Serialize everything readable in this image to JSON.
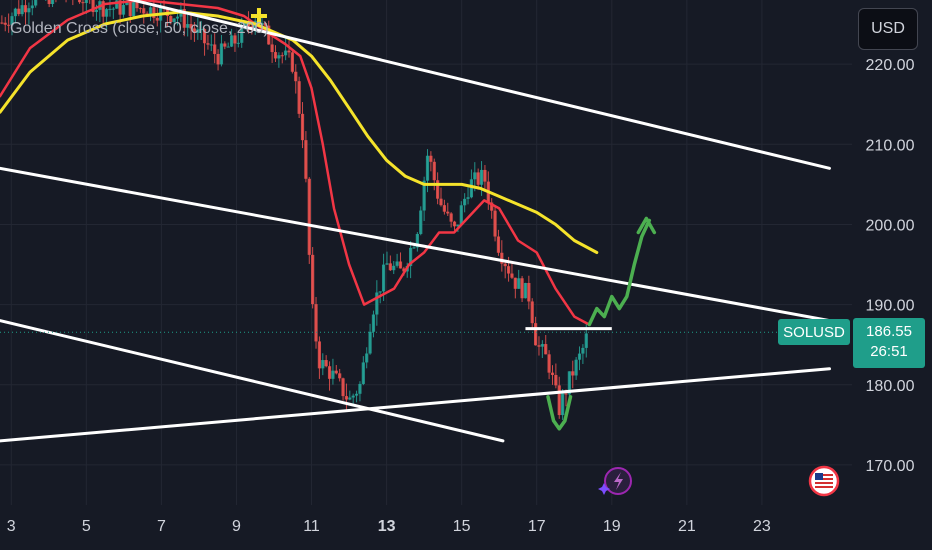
{
  "indicator": {
    "label": "Golden Cross (close, 50, close, 200)"
  },
  "currency_button": {
    "label": "USD"
  },
  "last_price": {
    "symbol": "SOLUSD",
    "price": "186.55",
    "countdown": "26:51"
  },
  "colors": {
    "background": "#161a25",
    "grid": "#232733",
    "ma_fast": "#f23645",
    "ma_slow": "#f5e32b",
    "candle_up": "#26a69a",
    "candle_down": "#ef5350",
    "trendline": "#ffffff",
    "projection": "#4caf50",
    "cross_marker": "#f5e32b",
    "price_line": "#1f9e8a"
  },
  "icons": {
    "lightning": "lightning-sparkle-icon",
    "flag": "us-flag-icon"
  },
  "chart_data": {
    "type": "line",
    "title": "",
    "xlabel": "",
    "ylabel": "",
    "x_ticks": [
      "3",
      "5",
      "7",
      "9",
      "11",
      "13",
      "15",
      "17",
      "19",
      "21",
      "23"
    ],
    "x_tick_values": [
      3,
      5,
      7,
      9,
      11,
      13,
      15,
      17,
      19,
      21,
      23
    ],
    "bold_x_ticks": [
      "13"
    ],
    "y_ticks": [
      "170.00",
      "180.00",
      "190.00",
      "200.00",
      "210.00",
      "220.00"
    ],
    "y_tick_values": [
      170,
      180,
      190,
      200,
      210,
      220
    ],
    "xlim": [
      2.7,
      25.4
    ],
    "ylim": [
      165,
      228
    ],
    "grid": true,
    "series": [
      {
        "key": "ma_fast",
        "x": [
          2.7,
          3.5,
          4.5,
          5.5,
          6.5,
          7.5,
          8.5,
          9.2,
          9.8,
          10.3,
          10.7,
          11.0,
          11.3,
          11.6,
          12.0,
          12.4,
          12.8,
          13.2,
          13.6,
          14.0,
          14.4,
          14.8,
          15.2,
          15.6,
          16.0,
          16.5,
          17.0,
          17.5,
          18.0,
          18.4
        ],
        "y": [
          216,
          222,
          225.5,
          227.5,
          228,
          227.5,
          227,
          226,
          224,
          222.5,
          221,
          217,
          210,
          202,
          195,
          190,
          191,
          192,
          195,
          196.5,
          199,
          199,
          201,
          203,
          202,
          198,
          196.5,
          192,
          188.5,
          187.5
        ]
      },
      {
        "key": "ma_slow",
        "x": [
          2.7,
          3.5,
          4.5,
          5.5,
          6.5,
          7.5,
          8.5,
          9.5,
          10.5,
          11.0,
          11.5,
          12.0,
          12.5,
          13.0,
          13.5,
          14.0,
          14.5,
          15.0,
          15.5,
          16.0,
          16.5,
          17.0,
          17.5,
          18.0,
          18.6
        ],
        "y": [
          214,
          219,
          223,
          225,
          226,
          226.5,
          226,
          225,
          223,
          221,
          218,
          214.5,
          211,
          208,
          206,
          205,
          205,
          205,
          204.5,
          203.5,
          202.5,
          201.5,
          200,
          198,
          196.5
        ]
      }
    ],
    "annotations": {
      "golden_cross": {
        "x": 9.6,
        "y": 226
      },
      "projection_path": {
        "x": [
          18.4,
          18.6,
          18.8,
          19.0,
          19.2,
          19.4,
          19.6,
          19.8,
          20.0
        ],
        "y": [
          187.5,
          189.5,
          188.5,
          191,
          189.5,
          191,
          195,
          198.5,
          200.5
        ]
      },
      "bottom_curve": {
        "x": [
          17.3,
          17.45,
          17.6,
          17.75,
          17.9
        ],
        "y": [
          178.5,
          175.5,
          174.5,
          175.5,
          178.5
        ]
      },
      "support_level": {
        "x": [
          16.7,
          19.0
        ],
        "y": 187.0
      },
      "trendlines": [
        {
          "x": [
            2.7,
            24.8
          ],
          "y": [
            232,
            207
          ]
        },
        {
          "x": [
            2.7,
            24.8
          ],
          "y": [
            207,
            188
          ]
        },
        {
          "x": [
            2.7,
            16.1
          ],
          "y": [
            188,
            173
          ]
        },
        {
          "x": [
            2.7,
            24.8
          ],
          "y": [
            173,
            182
          ]
        }
      ]
    }
  }
}
